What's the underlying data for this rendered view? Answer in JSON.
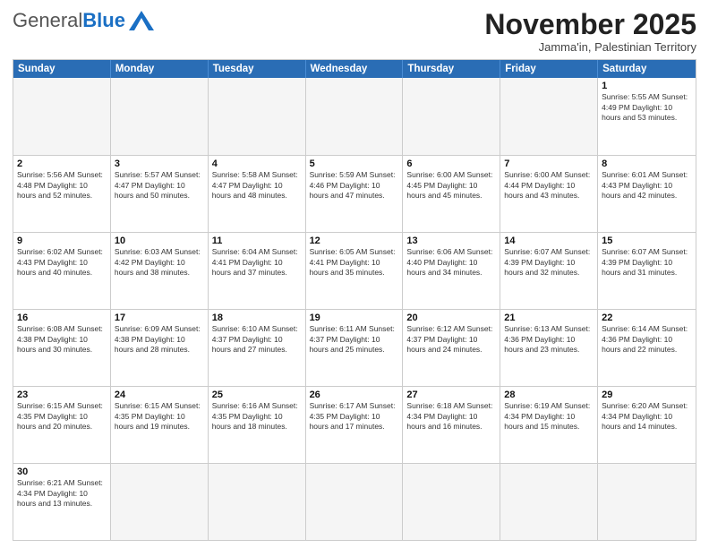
{
  "header": {
    "logo_general": "General",
    "logo_blue": "Blue",
    "month_title": "November 2025",
    "subtitle": "Jamma'in, Palestinian Territory"
  },
  "days_header": [
    "Sunday",
    "Monday",
    "Tuesday",
    "Wednesday",
    "Thursday",
    "Friday",
    "Saturday"
  ],
  "weeks": [
    [
      {
        "day": "",
        "info": ""
      },
      {
        "day": "",
        "info": ""
      },
      {
        "day": "",
        "info": ""
      },
      {
        "day": "",
        "info": ""
      },
      {
        "day": "",
        "info": ""
      },
      {
        "day": "",
        "info": ""
      },
      {
        "day": "1",
        "info": "Sunrise: 5:55 AM\nSunset: 4:49 PM\nDaylight: 10 hours and 53 minutes."
      }
    ],
    [
      {
        "day": "2",
        "info": "Sunrise: 5:56 AM\nSunset: 4:48 PM\nDaylight: 10 hours and 52 minutes."
      },
      {
        "day": "3",
        "info": "Sunrise: 5:57 AM\nSunset: 4:47 PM\nDaylight: 10 hours and 50 minutes."
      },
      {
        "day": "4",
        "info": "Sunrise: 5:58 AM\nSunset: 4:47 PM\nDaylight: 10 hours and 48 minutes."
      },
      {
        "day": "5",
        "info": "Sunrise: 5:59 AM\nSunset: 4:46 PM\nDaylight: 10 hours and 47 minutes."
      },
      {
        "day": "6",
        "info": "Sunrise: 6:00 AM\nSunset: 4:45 PM\nDaylight: 10 hours and 45 minutes."
      },
      {
        "day": "7",
        "info": "Sunrise: 6:00 AM\nSunset: 4:44 PM\nDaylight: 10 hours and 43 minutes."
      },
      {
        "day": "8",
        "info": "Sunrise: 6:01 AM\nSunset: 4:43 PM\nDaylight: 10 hours and 42 minutes."
      }
    ],
    [
      {
        "day": "9",
        "info": "Sunrise: 6:02 AM\nSunset: 4:43 PM\nDaylight: 10 hours and 40 minutes."
      },
      {
        "day": "10",
        "info": "Sunrise: 6:03 AM\nSunset: 4:42 PM\nDaylight: 10 hours and 38 minutes."
      },
      {
        "day": "11",
        "info": "Sunrise: 6:04 AM\nSunset: 4:41 PM\nDaylight: 10 hours and 37 minutes."
      },
      {
        "day": "12",
        "info": "Sunrise: 6:05 AM\nSunset: 4:41 PM\nDaylight: 10 hours and 35 minutes."
      },
      {
        "day": "13",
        "info": "Sunrise: 6:06 AM\nSunset: 4:40 PM\nDaylight: 10 hours and 34 minutes."
      },
      {
        "day": "14",
        "info": "Sunrise: 6:07 AM\nSunset: 4:39 PM\nDaylight: 10 hours and 32 minutes."
      },
      {
        "day": "15",
        "info": "Sunrise: 6:07 AM\nSunset: 4:39 PM\nDaylight: 10 hours and 31 minutes."
      }
    ],
    [
      {
        "day": "16",
        "info": "Sunrise: 6:08 AM\nSunset: 4:38 PM\nDaylight: 10 hours and 30 minutes."
      },
      {
        "day": "17",
        "info": "Sunrise: 6:09 AM\nSunset: 4:38 PM\nDaylight: 10 hours and 28 minutes."
      },
      {
        "day": "18",
        "info": "Sunrise: 6:10 AM\nSunset: 4:37 PM\nDaylight: 10 hours and 27 minutes."
      },
      {
        "day": "19",
        "info": "Sunrise: 6:11 AM\nSunset: 4:37 PM\nDaylight: 10 hours and 25 minutes."
      },
      {
        "day": "20",
        "info": "Sunrise: 6:12 AM\nSunset: 4:37 PM\nDaylight: 10 hours and 24 minutes."
      },
      {
        "day": "21",
        "info": "Sunrise: 6:13 AM\nSunset: 4:36 PM\nDaylight: 10 hours and 23 minutes."
      },
      {
        "day": "22",
        "info": "Sunrise: 6:14 AM\nSunset: 4:36 PM\nDaylight: 10 hours and 22 minutes."
      }
    ],
    [
      {
        "day": "23",
        "info": "Sunrise: 6:15 AM\nSunset: 4:35 PM\nDaylight: 10 hours and 20 minutes."
      },
      {
        "day": "24",
        "info": "Sunrise: 6:15 AM\nSunset: 4:35 PM\nDaylight: 10 hours and 19 minutes."
      },
      {
        "day": "25",
        "info": "Sunrise: 6:16 AM\nSunset: 4:35 PM\nDaylight: 10 hours and 18 minutes."
      },
      {
        "day": "26",
        "info": "Sunrise: 6:17 AM\nSunset: 4:35 PM\nDaylight: 10 hours and 17 minutes."
      },
      {
        "day": "27",
        "info": "Sunrise: 6:18 AM\nSunset: 4:34 PM\nDaylight: 10 hours and 16 minutes."
      },
      {
        "day": "28",
        "info": "Sunrise: 6:19 AM\nSunset: 4:34 PM\nDaylight: 10 hours and 15 minutes."
      },
      {
        "day": "29",
        "info": "Sunrise: 6:20 AM\nSunset: 4:34 PM\nDaylight: 10 hours and 14 minutes."
      }
    ],
    [
      {
        "day": "30",
        "info": "Sunrise: 6:21 AM\nSunset: 4:34 PM\nDaylight: 10 hours and 13 minutes."
      },
      {
        "day": "",
        "info": ""
      },
      {
        "day": "",
        "info": ""
      },
      {
        "day": "",
        "info": ""
      },
      {
        "day": "",
        "info": ""
      },
      {
        "day": "",
        "info": ""
      },
      {
        "day": "",
        "info": ""
      }
    ]
  ]
}
